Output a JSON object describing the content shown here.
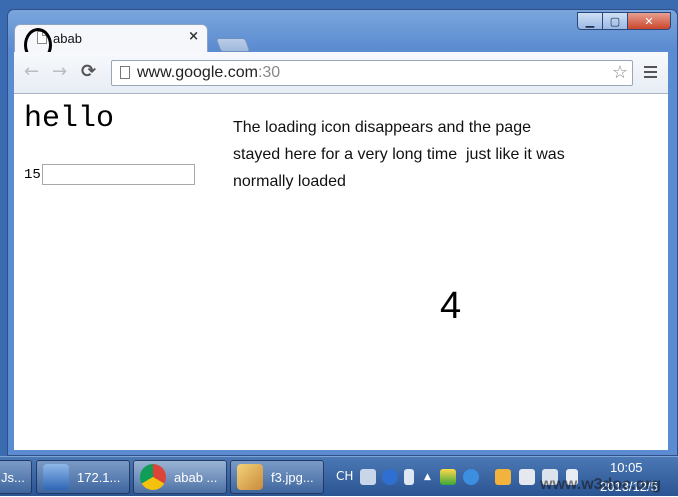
{
  "browser": {
    "tab": {
      "title": "abab",
      "close_glyph": "×",
      "favicon": "blank-page-icon"
    },
    "window_controls": {
      "minimize": "▁",
      "maximize": "▢",
      "close": "✕"
    },
    "nav": {
      "back": "←",
      "forward": "→",
      "reload": "⟳"
    },
    "address": {
      "host": "www.google.com",
      "port": ":30"
    },
    "bookmark_star": "☆"
  },
  "page": {
    "heading": "hello",
    "input_label": "15",
    "input_value": "",
    "message_lines": [
      "The loading icon disappears and the page",
      "stayed here for a very long time  just like it was",
      "normally loaded"
    ],
    "big_number": "4"
  },
  "taskbar": {
    "items": [
      {
        "label": "Js...",
        "icon": "partial-app-icon"
      },
      {
        "label": "172.1...",
        "icon": "remote-desktop-icon"
      },
      {
        "label": "abab ...",
        "icon": "chrome-icon"
      },
      {
        "label": "f3.jpg...",
        "icon": "paint-icon"
      }
    ],
    "tray": {
      "lang": "CH",
      "time": "10:05",
      "date": "2013/12/5"
    }
  },
  "watermark": "www.w3doc.org",
  "colors": {
    "window_frame": "#5b8bd0",
    "taskbar": "#2b5592",
    "close_button": "#c9462c"
  }
}
